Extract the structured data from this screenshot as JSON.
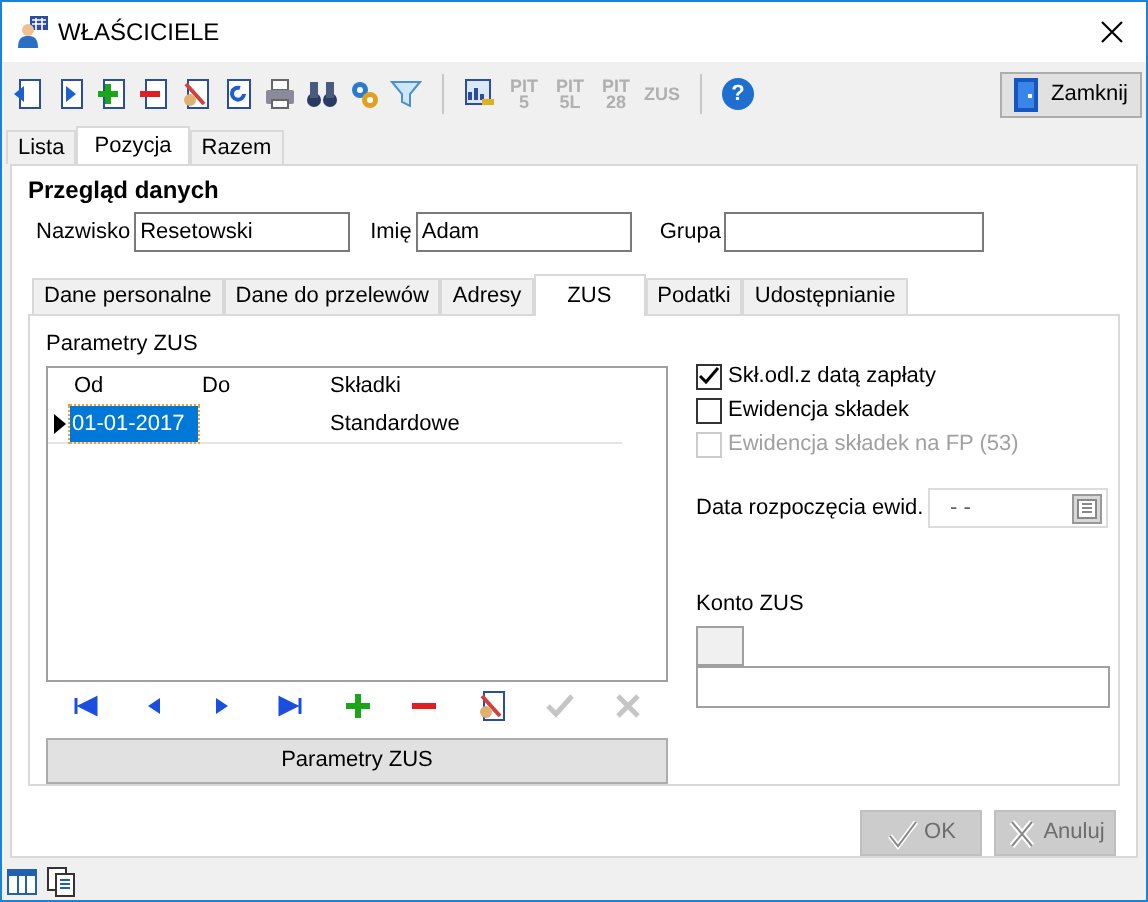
{
  "window": {
    "title": "WŁAŚCICIELE"
  },
  "toolbar": {
    "pit_icons": [
      {
        "lines": [
          "PIT",
          "5"
        ],
        "disabled": true
      },
      {
        "lines": [
          "PIT",
          "5L"
        ],
        "disabled": true
      },
      {
        "lines": [
          "PIT",
          "28"
        ],
        "disabled": true
      },
      {
        "lines": [
          "ZUS"
        ],
        "disabled": true
      }
    ],
    "help_glyph": "?",
    "close_button": "Zamknij"
  },
  "tabs": [
    {
      "label": "Lista",
      "selected": false
    },
    {
      "label": "Pozycja",
      "selected": true
    },
    {
      "label": "Razem",
      "selected": false
    }
  ],
  "section_title": "Przegląd danych",
  "fields": [
    {
      "label": "Nazwisko",
      "value": "Resetowski"
    },
    {
      "label": "Imię",
      "value": "Adam"
    },
    {
      "label": "Grupa"
    }
  ],
  "subtabs": [
    {
      "label": "Dane personalne",
      "selected": false
    },
    {
      "label": "Dane do przelewów",
      "selected": false
    },
    {
      "label": "Adresy",
      "selected": false
    },
    {
      "label": "ZUS",
      "selected": true
    },
    {
      "label": "Podatki",
      "selected": false
    },
    {
      "label": "Udostępnianie",
      "selected": false
    }
  ],
  "zus": {
    "group_label": "Parametry ZUS",
    "columns": [
      "Od",
      "Do",
      "Składki"
    ],
    "rows": [
      {
        "od": "01-01-2017",
        "skladki": "Standardowe",
        "selected": true
      }
    ],
    "nav": [
      {
        "kind": "first",
        "disabled": false
      },
      {
        "kind": "prev",
        "disabled": false
      },
      {
        "kind": "next",
        "disabled": false
      },
      {
        "kind": "last",
        "disabled": false
      },
      {
        "kind": "add",
        "disabled": false
      },
      {
        "kind": "remove",
        "disabled": false
      },
      {
        "kind": "edit",
        "disabled": false
      },
      {
        "kind": "confirm",
        "disabled": true
      },
      {
        "kind": "cancel",
        "disabled": true
      }
    ],
    "button": "Parametry ZUS"
  },
  "checkboxes": [
    {
      "label": "Skł.odl.z datą zapłaty",
      "checked": true,
      "disabled": false
    },
    {
      "label": "Ewidencja składek",
      "checked": false,
      "disabled": false
    },
    {
      "label": "Ewidencja składek na FP (53)",
      "checked": false,
      "disabled": true
    }
  ],
  "start_date": {
    "label": "Data rozpoczęcia ewid.",
    "value": "- -"
  },
  "account": {
    "label": "Konto ZUS"
  },
  "dialog_buttons": [
    {
      "label": "OK",
      "kind": "ok",
      "disabled": true
    },
    {
      "label": "Anuluj",
      "kind": "cancel",
      "disabled": true
    }
  ]
}
